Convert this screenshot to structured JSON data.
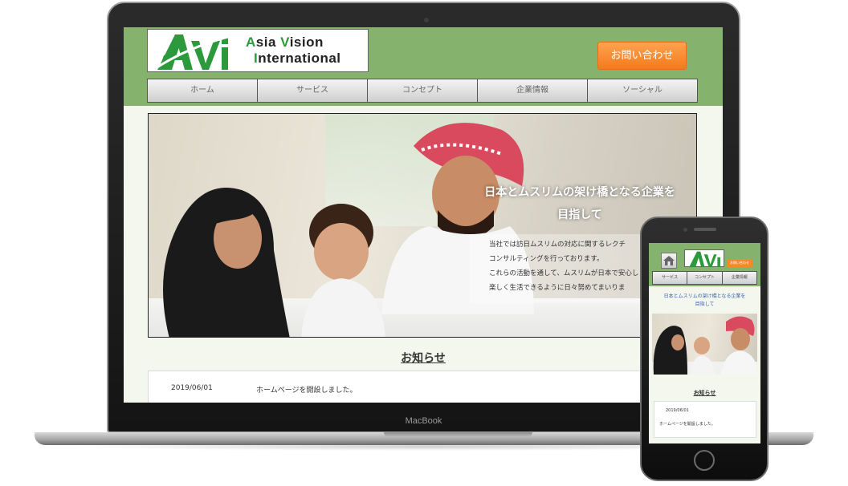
{
  "laptop": {
    "brand": "MacBook"
  },
  "site": {
    "logo": {
      "mark": "AVi",
      "line1_a": "A",
      "line1_b": "sia ",
      "line1_c": "V",
      "line1_d": "ision",
      "line2_a": "I",
      "line2_b": "nternational"
    },
    "contact_label": "お問い合わせ",
    "nav": [
      "ホーム",
      "サービス",
      "コンセプト",
      "企業情報",
      "ソーシャル"
    ],
    "hero": {
      "title_line1": "日本とムスリムの架け橋となる企業を",
      "title_line2": "目指して",
      "desc": [
        "当社では訪日ムスリムの対応に関するレクチ",
        "コンサルティングを行っております。",
        "これらの活動を通して、ムスリムが日本で安心し",
        "楽しく生活できるように日々努めてまいりま"
      ]
    },
    "notice": {
      "title": "お知らせ",
      "items": [
        {
          "date": "2019/06/01",
          "text": "ホームページを開設しました。"
        }
      ]
    }
  },
  "phone": {
    "contact_label": "お問い合わせ",
    "nav": [
      "サービス",
      "コンセプト",
      "企業情報"
    ],
    "hero_text_line1": "日本とムスリムの架け橋となる企業を",
    "hero_text_line2": "目指して",
    "notice_title": "お知らせ",
    "notice_date": "2019/06/01",
    "notice_text": "ホームページを開設しました。"
  },
  "colors": {
    "header_green": "#85b26d",
    "logo_green": "#2c9a3c",
    "contact_orange": "#f27b1d",
    "page_bg": "#f3f7ee"
  }
}
